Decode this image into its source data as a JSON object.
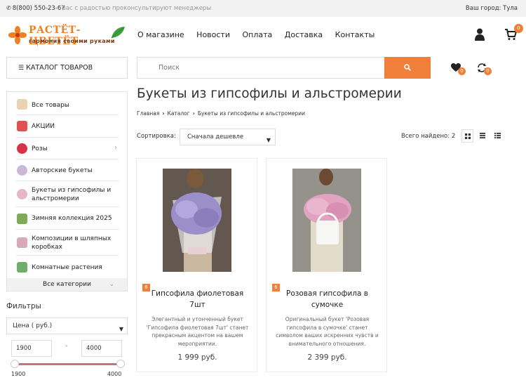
{
  "topbar": {
    "phone": "8(800) 550-23-67",
    "subtitle": "Вас с радостью проконсультируют менеджеры",
    "city": "Ваш город: Тула"
  },
  "logo": {
    "title": "РАСТЁТ-ЦВЕТЁТ",
    "tagline": "гармония своими руками"
  },
  "nav": [
    "О магазине",
    "Новости",
    "Оплата",
    "Доставка",
    "Контакты"
  ],
  "header": {
    "cart_count": "0",
    "wishlist_count": "0",
    "compare_count": "0",
    "catalog_label": "КАТАЛОГ ТОВАРОВ",
    "search_placeholder": "Поиск"
  },
  "sidebar": {
    "items": [
      {
        "label": "Все товары",
        "icon": "cart-icon"
      },
      {
        "label": "АКЦИИ",
        "icon": "percent-icon"
      },
      {
        "label": "Розы",
        "icon": "rose-icon"
      },
      {
        "label": "Авторские букеты",
        "icon": "bouquet-icon"
      },
      {
        "label": "Букеты из гипсофилы и альстромерии",
        "icon": "gypsophila-icon"
      },
      {
        "label": "Зимняя коллекция 2025",
        "icon": "tree-icon"
      },
      {
        "label": "Композиции в шляпных коробках",
        "icon": "hatbox-icon"
      },
      {
        "label": "Комнатные растения",
        "icon": "plant-icon"
      }
    ],
    "all_categories": "Все категории"
  },
  "filters": {
    "title": "Фильтры",
    "price_label": "Цена ( руб.)",
    "min": "1900",
    "max": "4000",
    "range_min_label": "1900",
    "range_max_label": "4000"
  },
  "main": {
    "title": "Букеты из гипсофилы и альстромерии",
    "breadcrumb": [
      "Главная",
      "Каталог",
      "Букеты из гипсофилы и альстромерии"
    ],
    "sort_label": "Сортировка:",
    "sort_value": "Сначала дешевле",
    "found": "Всего найдено: 2"
  },
  "products": [
    {
      "tag": "6",
      "name": "Гипсофила фиолетовая 7шт",
      "desc": "Элегантный и утонченный букет 'Гипсофила фиолетовая 7шт' станет прекрасным акцентом на вашем мероприятии.",
      "price": "1 999 руб."
    },
    {
      "tag": "6",
      "name": "Розовая гипсофила в сумочке",
      "desc": "Оригинальный букет 'Розовая гипсофила в сумочке' станет символом ваших искренних чувств и внимательного отношения.",
      "price": "2 399 руб."
    }
  ],
  "colors": {
    "accent": "#f07f3a",
    "logo_orange": "#f07f1f",
    "logo_brown": "#7a3b1a"
  }
}
